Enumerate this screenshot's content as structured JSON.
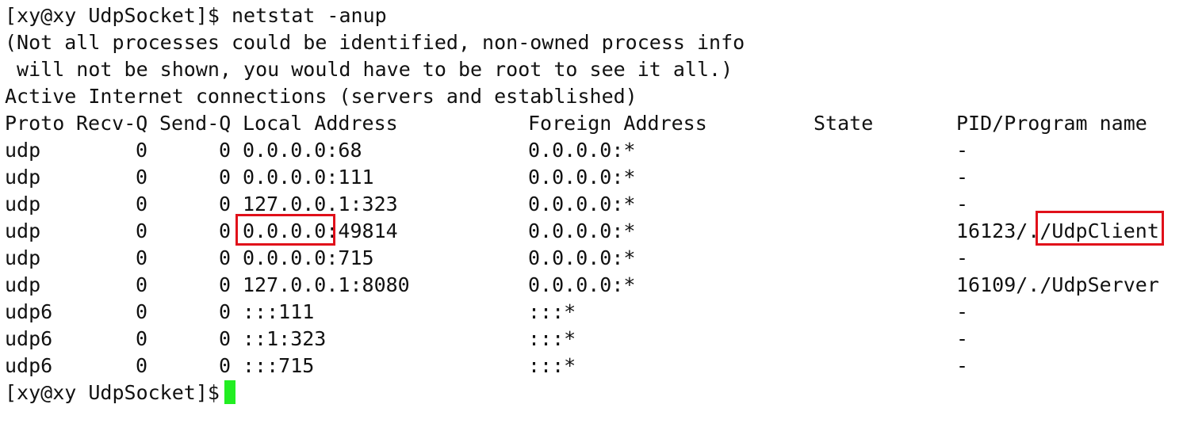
{
  "prompt": "[xy@xy UdpSocket]$",
  "command": "netstat -anup",
  "notice_lines": [
    "(Not all processes could be identified, non-owned process info",
    " will not be shown, you would have to be root to see it all.)"
  ],
  "section_title": "Active Internet connections (servers and established)",
  "columns": [
    "Proto",
    "Recv-Q",
    "Send-Q",
    "Local Address",
    "Foreign Address",
    "State",
    "PID/Program name"
  ],
  "rows": [
    {
      "proto": "udp",
      "recvq": "0",
      "sendq": "0",
      "local": "0.0.0.0:68",
      "foreign": "0.0.0.0:*",
      "state": "",
      "pid": "-"
    },
    {
      "proto": "udp",
      "recvq": "0",
      "sendq": "0",
      "local": "0.0.0.0:111",
      "foreign": "0.0.0.0:*",
      "state": "",
      "pid": "-"
    },
    {
      "proto": "udp",
      "recvq": "0",
      "sendq": "0",
      "local": "127.0.0.1:323",
      "foreign": "0.0.0.0:*",
      "state": "",
      "pid": "-"
    },
    {
      "proto": "udp",
      "recvq": "0",
      "sendq": "0",
      "local": "0.0.0.0:49814",
      "foreign": "0.0.0.0:*",
      "state": "",
      "pid": "16123/./UdpClient"
    },
    {
      "proto": "udp",
      "recvq": "0",
      "sendq": "0",
      "local": "0.0.0.0:715",
      "foreign": "0.0.0.0:*",
      "state": "",
      "pid": "-"
    },
    {
      "proto": "udp",
      "recvq": "0",
      "sendq": "0",
      "local": "127.0.0.1:8080",
      "foreign": "0.0.0.0:*",
      "state": "",
      "pid": "16109/./UdpServer"
    },
    {
      "proto": "udp6",
      "recvq": "0",
      "sendq": "0",
      "local": ":::111",
      "foreign": ":::*",
      "state": "",
      "pid": "-"
    },
    {
      "proto": "udp6",
      "recvq": "0",
      "sendq": "0",
      "local": "::1:323",
      "foreign": ":::*",
      "state": "",
      "pid": "-"
    },
    {
      "proto": "udp6",
      "recvq": "0",
      "sendq": "0",
      "local": ":::715",
      "foreign": ":::*",
      "state": "",
      "pid": "-"
    }
  ],
  "highlight_color": "#e0101a",
  "cursor_color": "#22ee22",
  "text_color": "#111111",
  "background_color": "#ffffff"
}
